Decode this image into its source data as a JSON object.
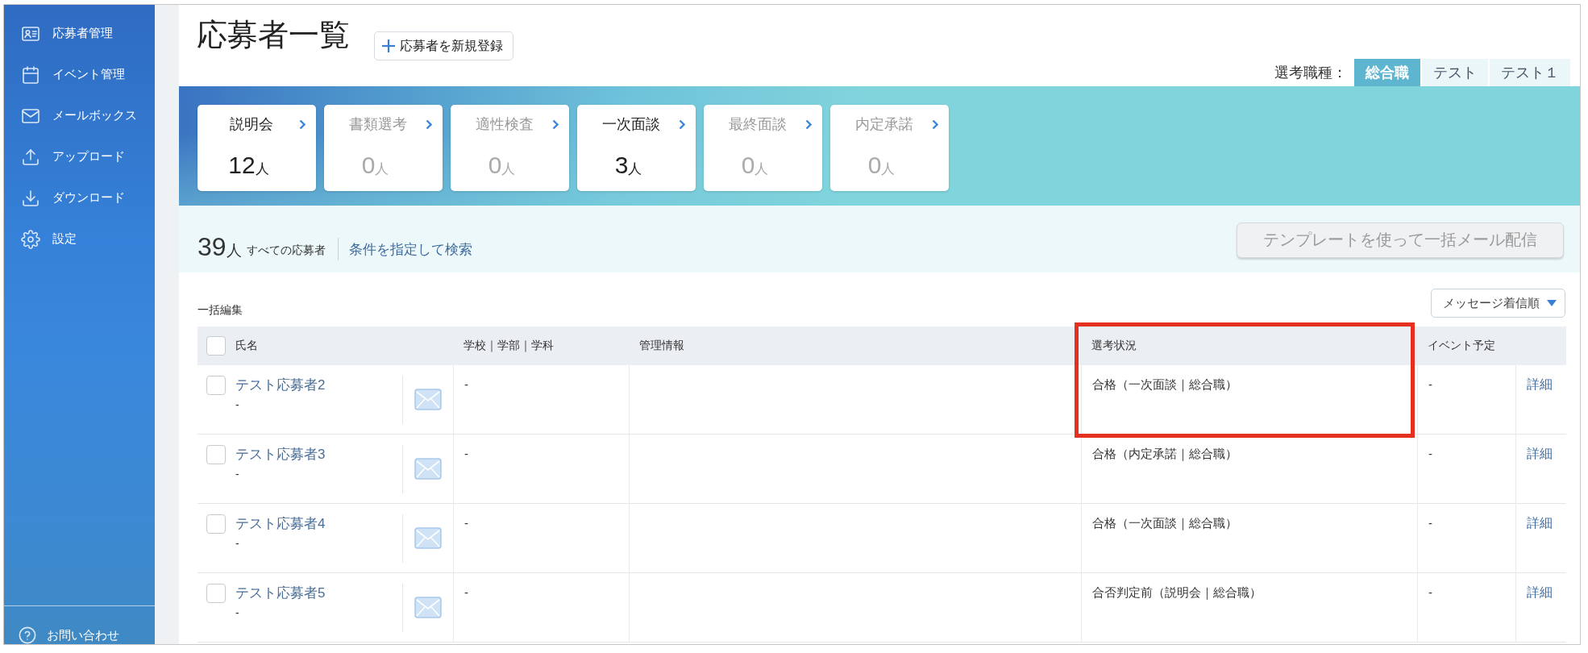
{
  "sidebar": {
    "items": [
      {
        "label": "応募者管理",
        "selected": false
      },
      {
        "label": "イベント管理",
        "selected": false
      },
      {
        "label": "メールボックス",
        "selected": false
      },
      {
        "label": "アップロード",
        "selected": false
      },
      {
        "label": "ダウンロード",
        "selected": false
      },
      {
        "label": "設定",
        "selected": false
      }
    ],
    "footer": {
      "label": "お問い合わせ"
    }
  },
  "header": {
    "title": "応募者一覧",
    "new_button": "応募者を新規登録",
    "job_type": {
      "label": "選考職種：",
      "tabs": [
        {
          "label": "総合職",
          "selected": true
        },
        {
          "label": "テスト",
          "selected": false
        },
        {
          "label": "テスト１",
          "selected": false
        }
      ]
    }
  },
  "stages": [
    {
      "label": "説明会",
      "count": "12",
      "unit": "人",
      "dimmed": false
    },
    {
      "label": "書類選考",
      "count": "0",
      "unit": "人",
      "dimmed": true
    },
    {
      "label": "適性検査",
      "count": "0",
      "unit": "人",
      "dimmed": true
    },
    {
      "label": "一次面談",
      "count": "3",
      "unit": "人",
      "dimmed": false
    },
    {
      "label": "最終面談",
      "count": "0",
      "unit": "人",
      "dimmed": true
    },
    {
      "label": "内定承諾",
      "count": "0",
      "unit": "人",
      "dimmed": true
    }
  ],
  "summary": {
    "count": "39",
    "unit": "人",
    "label": "すべての応募者",
    "search_link": "条件を指定して検索",
    "mail_button": {
      "label": "テンプレートを使って一括メール配信",
      "disabled": true
    }
  },
  "bulk_edit": "一括編集",
  "sort": {
    "value": "メッセージ着信順"
  },
  "table": {
    "highlight_frame": true,
    "select_all": {
      "checked": false
    },
    "columns": [
      "氏名",
      "学校｜学部｜学科",
      "管理情報",
      "選考状況",
      "イベント予定"
    ],
    "rows": [
      {
        "checked": false,
        "name": "テスト応募者2",
        "note": "-",
        "school": "-",
        "status": "合格（一次面談｜総合職）",
        "event": "-",
        "detail": "詳細"
      },
      {
        "checked": false,
        "name": "テスト応募者3",
        "note": "-",
        "school": "-",
        "status": "合格（内定承諾｜総合職）",
        "event": "-",
        "detail": "詳細"
      },
      {
        "checked": false,
        "name": "テスト応募者4",
        "note": "-",
        "school": "-",
        "status": "合格（一次面談｜総合職）",
        "event": "-",
        "detail": "詳細"
      },
      {
        "checked": false,
        "name": "テスト応募者5",
        "note": "-",
        "school": "-",
        "status": "合否判定前（説明会｜総合職）",
        "event": "-",
        "detail": "詳細"
      }
    ]
  }
}
